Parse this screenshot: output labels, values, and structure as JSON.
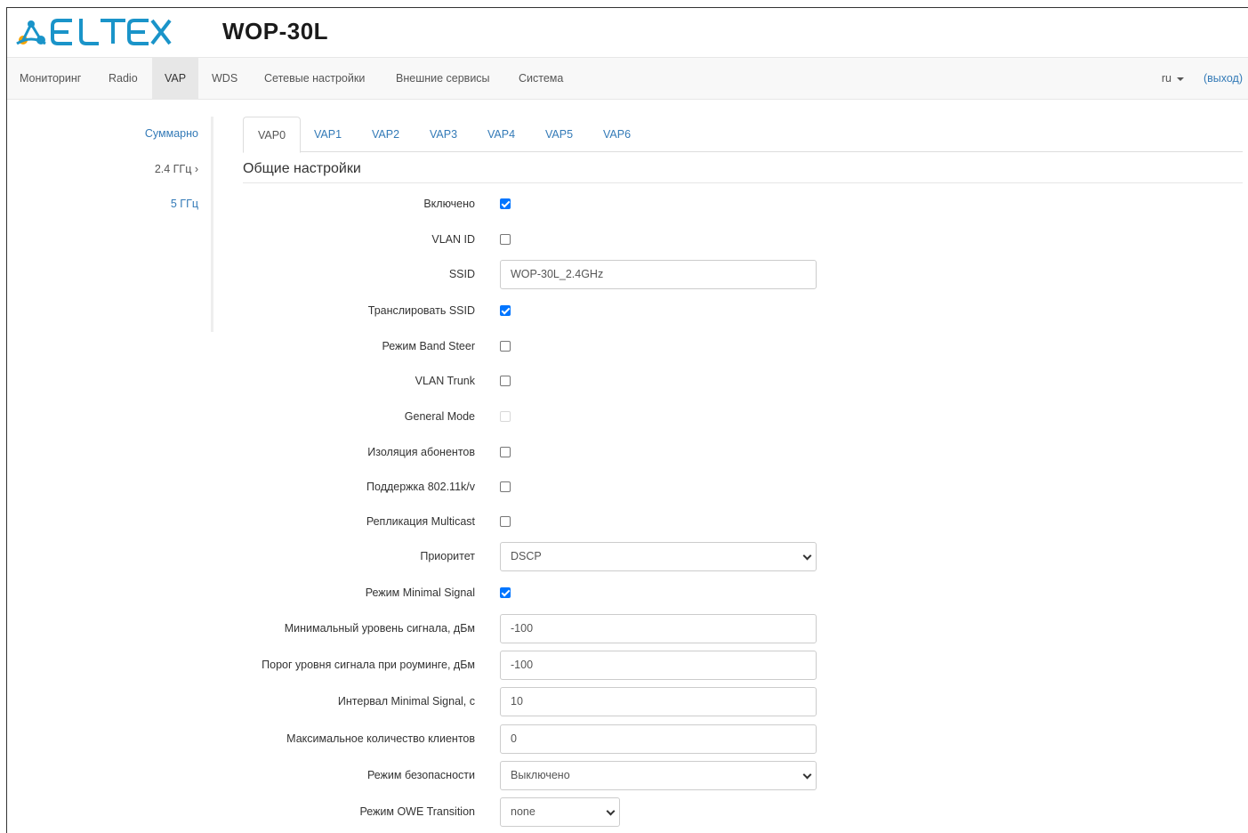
{
  "header": {
    "model": "WOP-30L"
  },
  "nav": {
    "items": [
      "Мониторинг",
      "Radio",
      "VAP",
      "WDS",
      "Сетевые настройки",
      "Внешние сервисы",
      "Система"
    ],
    "active": "VAP",
    "lang": "ru",
    "logout": "(выход)"
  },
  "sidebar": {
    "items": [
      "Суммарно",
      "2.4 ГГц ›",
      "5 ГГц"
    ]
  },
  "tabs": {
    "items": [
      "VAP0",
      "VAP1",
      "VAP2",
      "VAP3",
      "VAP4",
      "VAP5",
      "VAP6"
    ],
    "active": "VAP0"
  },
  "section": {
    "title": "Общие настройки"
  },
  "form": {
    "enabled": {
      "label": "Включено",
      "checked": true
    },
    "vlan_id": {
      "label": "VLAN ID",
      "checked": false
    },
    "ssid": {
      "label": "SSID",
      "value": "WOP-30L_2.4GHz"
    },
    "broadcast_ssid": {
      "label": "Транслировать SSID",
      "checked": true
    },
    "band_steer": {
      "label": "Режим Band Steer",
      "checked": false
    },
    "vlan_trunk": {
      "label": "VLAN Trunk",
      "checked": false
    },
    "general_mode": {
      "label": "General Mode",
      "checked": false,
      "disabled": true
    },
    "isolation": {
      "label": "Изоляция абонентов",
      "checked": false
    },
    "support_80211kv": {
      "label": "Поддержка 802.11k/v",
      "checked": false
    },
    "multicast": {
      "label": "Репликация Multicast",
      "checked": false
    },
    "priority": {
      "label": "Приоритет",
      "value": "DSCP"
    },
    "minimal_signal": {
      "label": "Режим Minimal Signal",
      "checked": true
    },
    "min_signal_level": {
      "label": "Минимальный уровень сигнала, дБм",
      "value": "-100"
    },
    "roaming_threshold": {
      "label": "Порог уровня сигнала при роуминге, дБм",
      "value": "-100"
    },
    "ms_interval": {
      "label": "Интервал Minimal Signal, с",
      "value": "10"
    },
    "max_clients": {
      "label": "Максимальное количество клиентов",
      "value": "0"
    },
    "security_mode": {
      "label": "Режим безопасности",
      "value": "Выключено"
    },
    "owe_transition": {
      "label": "Режим OWE Transition",
      "value": "none"
    }
  },
  "colors": {
    "brand": "#1a94c9",
    "link": "#337ab7",
    "checkbox": "#0075ff"
  }
}
